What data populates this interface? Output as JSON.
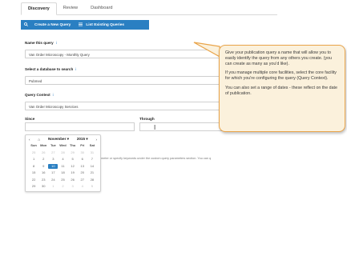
{
  "tabs": [
    {
      "label": "Discovery"
    },
    {
      "label": "Review"
    },
    {
      "label": "Dashboard"
    }
  ],
  "toolbar": {
    "create_label": "Create a New Query",
    "list_label": "List Existing Queries",
    "create_icon": "search-icon",
    "list_icon": "list-icon"
  },
  "form": {
    "name_label": "Name this query",
    "name_value": "Van Order Microscopy - Monthly Query",
    "db_label": "Select a database to search",
    "db_value": "Pubmed",
    "context_label": "Query Context",
    "context_value": "Van Order Microscopy Services",
    "since_label": "Since",
    "through_label": "Through",
    "info_glyph": "i"
  },
  "calendar": {
    "month": "November",
    "year": "2015",
    "prev_glyph": "‹",
    "home_glyph": "⌂",
    "next_glyph": "›",
    "caret_glyph": "▾",
    "weekdays": [
      "Sun",
      "Mon",
      "Tue",
      "Wed",
      "Thu",
      "Fri",
      "Sat"
    ],
    "weeks": [
      [
        "25",
        "26",
        "27",
        "28",
        "29",
        "30",
        "31"
      ],
      [
        "1",
        "2",
        "3",
        "4",
        "5",
        "6",
        "7"
      ],
      [
        "8",
        "9",
        "10",
        "11",
        "12",
        "13",
        "14"
      ],
      [
        "15",
        "16",
        "17",
        "18",
        "19",
        "20",
        "21"
      ],
      [
        "22",
        "23",
        "24",
        "25",
        "26",
        "27",
        "28"
      ],
      [
        "29",
        "30",
        "1",
        "2",
        "3",
        "4",
        "5"
      ]
    ],
    "selected": "10"
  },
  "hint_text": "meter or specify keywords under the custom query parameters section. You can q",
  "callout": {
    "p1": "Give your publication query a name that will allow you to easily identify the query from any others you create. (you can create as many as you'd like).",
    "p2": "If you manage multiple core facilities, select the core facility for which you're configuring the query (Query Context).",
    "p3": "You can also set a range of dates - these reflect on the date of publication."
  },
  "colors": {
    "accent": "#2a7fc2",
    "callout_border": "#e9a44a",
    "callout_bg": "#fbf1dc"
  }
}
